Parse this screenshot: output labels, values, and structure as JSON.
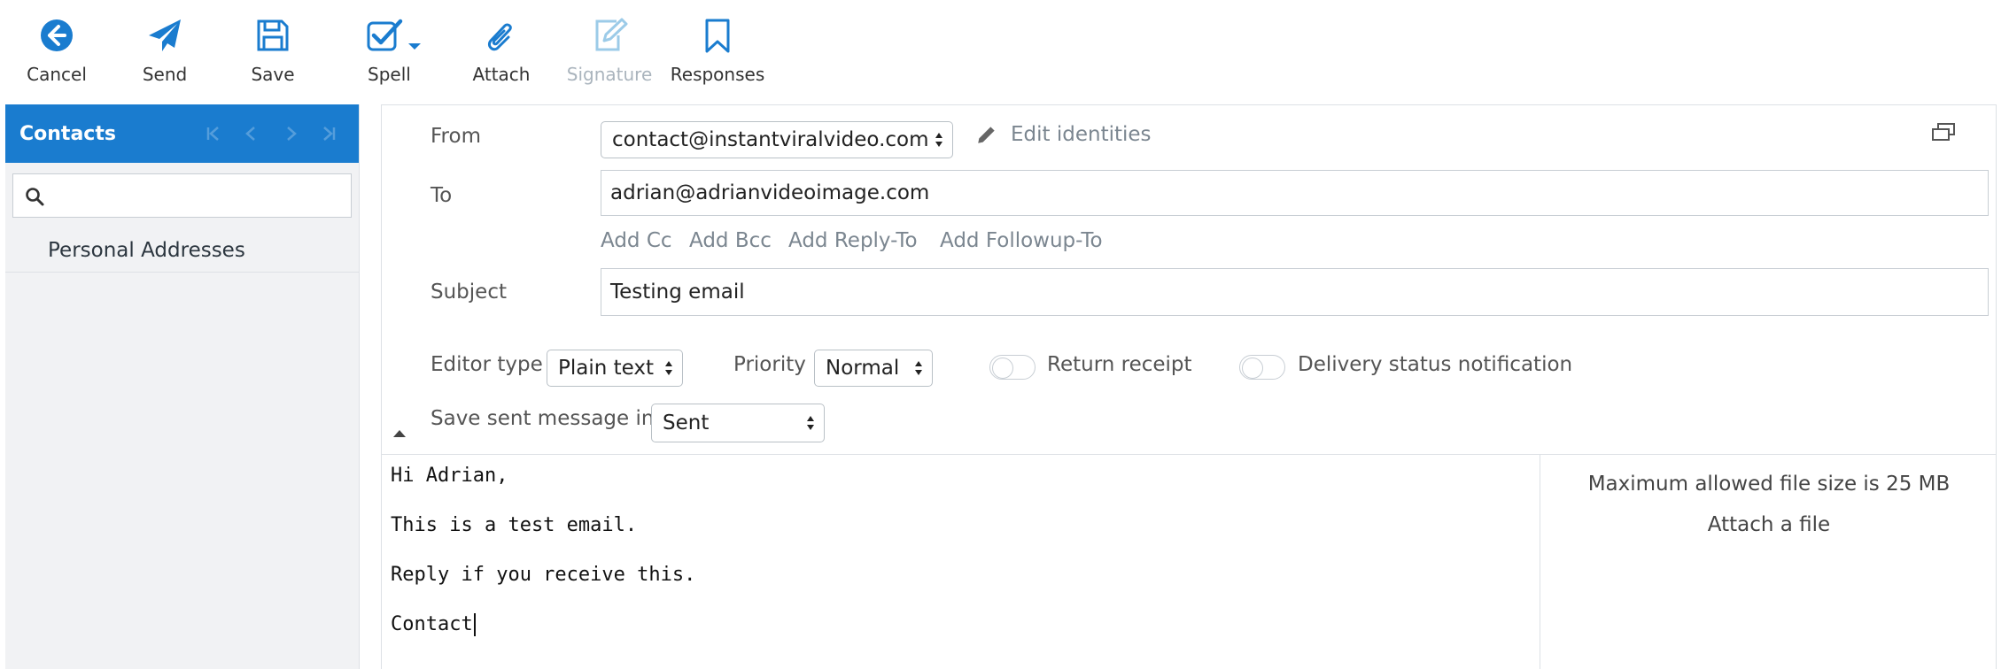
{
  "toolbar": {
    "cancel": "Cancel",
    "send": "Send",
    "save": "Save",
    "spell": "Spell",
    "attach": "Attach",
    "signature": "Signature",
    "responses": "Responses"
  },
  "colors": {
    "accent": "#1a7ccf",
    "disabled": "#aab4bd"
  },
  "sidebar": {
    "title": "Contacts",
    "search_value": "",
    "items": [
      {
        "label": "Personal Addresses"
      }
    ]
  },
  "compose": {
    "from_label": "From",
    "from_value": "contact@instantviralvideo.com",
    "edit_identities": "Edit identities",
    "to_label": "To",
    "to_value": "adrian@adrianvideoimage.com",
    "add_cc": "Add Cc",
    "add_bcc": "Add Bcc",
    "add_reply_to": "Add Reply-To",
    "add_followup_to": "Add Followup-To",
    "subject_label": "Subject",
    "subject_value": "Testing email",
    "editor_type_label": "Editor type",
    "editor_type_value": "Plain text",
    "priority_label": "Priority",
    "priority_value": "Normal",
    "return_receipt": "Return receipt",
    "dsn": "Delivery status notification",
    "save_sent_label": "Save sent message in",
    "save_sent_value": "Sent",
    "body_lines": [
      "Hi Adrian,",
      "This is a test email.",
      "Reply if you receive this.",
      "Contact"
    ]
  },
  "attachments": {
    "max_size": "Maximum allowed file size is 25 MB",
    "attach_link": "Attach a file"
  }
}
